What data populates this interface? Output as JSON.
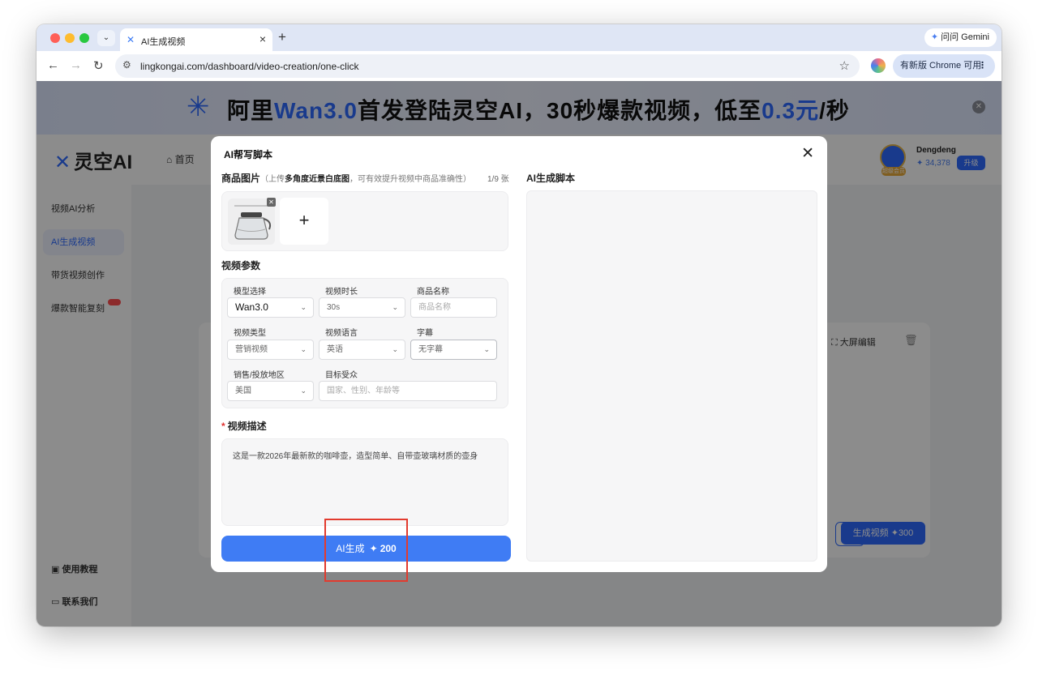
{
  "browser": {
    "tab_title": "AI生成视频",
    "url": "lingkongai.com/dashboard/video-creation/one-click",
    "gemini_label": "问问 Gemini",
    "update_label": "有新版 Chrome 可用"
  },
  "banner": {
    "text_1": "阿里",
    "text_2": "Wan3.0",
    "text_3": "首发登陆灵空AI，30秒爆款视频，低至",
    "text_4": "0.3元",
    "text_5": "/秒"
  },
  "app": {
    "brand": "灵空AI",
    "home": "首页",
    "user_name": "Dengdeng",
    "user_credits": "34,378",
    "upgrade": "升级",
    "avatar_badge": "超级会员",
    "bigscreen": "大屏编辑",
    "gen_video": "生成视频 ✦300"
  },
  "sidebar": {
    "items": [
      {
        "label": "视频AI分析"
      },
      {
        "label": "AI生成视频"
      },
      {
        "label": "带货视频创作"
      },
      {
        "label": "爆款智能复刻"
      }
    ],
    "bottom": [
      {
        "label": "使用教程"
      },
      {
        "label": "联系我们"
      }
    ]
  },
  "modal": {
    "title": "AI帮写脚本",
    "product_images_label": "商品图片",
    "hint_prefix": "（上传",
    "hint_bold": "多角度近景白底图",
    "hint_suffix": "，可有效提升视频中商品准确性）",
    "counter": "1/9 张",
    "script_label": "AI生成脚本",
    "params_label": "视频参数",
    "fields": {
      "model_label": "模型选择",
      "model_value": "Wan3.0",
      "duration_label": "视频时长",
      "duration_value": "30s",
      "product_name_label": "商品名称",
      "product_name_placeholder": "商品名称",
      "type_label": "视频类型",
      "type_value": "营销视频",
      "language_label": "视频语言",
      "language_value": "英语",
      "subtitle_label": "字幕",
      "subtitle_value": "无字幕",
      "region_label": "销售/投放地区",
      "region_value": "美国",
      "audience_label": "目标受众",
      "audience_placeholder": "国家、性别、年龄等"
    },
    "desc_label": "视频描述",
    "desc_value": "这是一款2026年最新款的咖啡壶，造型简单、自带壶玻璃材质的壶身",
    "gen_label": "AI生成",
    "gen_cost": "200"
  },
  "colors": {
    "accent": "#3f7cf4",
    "highlight": "#e23b2e"
  }
}
